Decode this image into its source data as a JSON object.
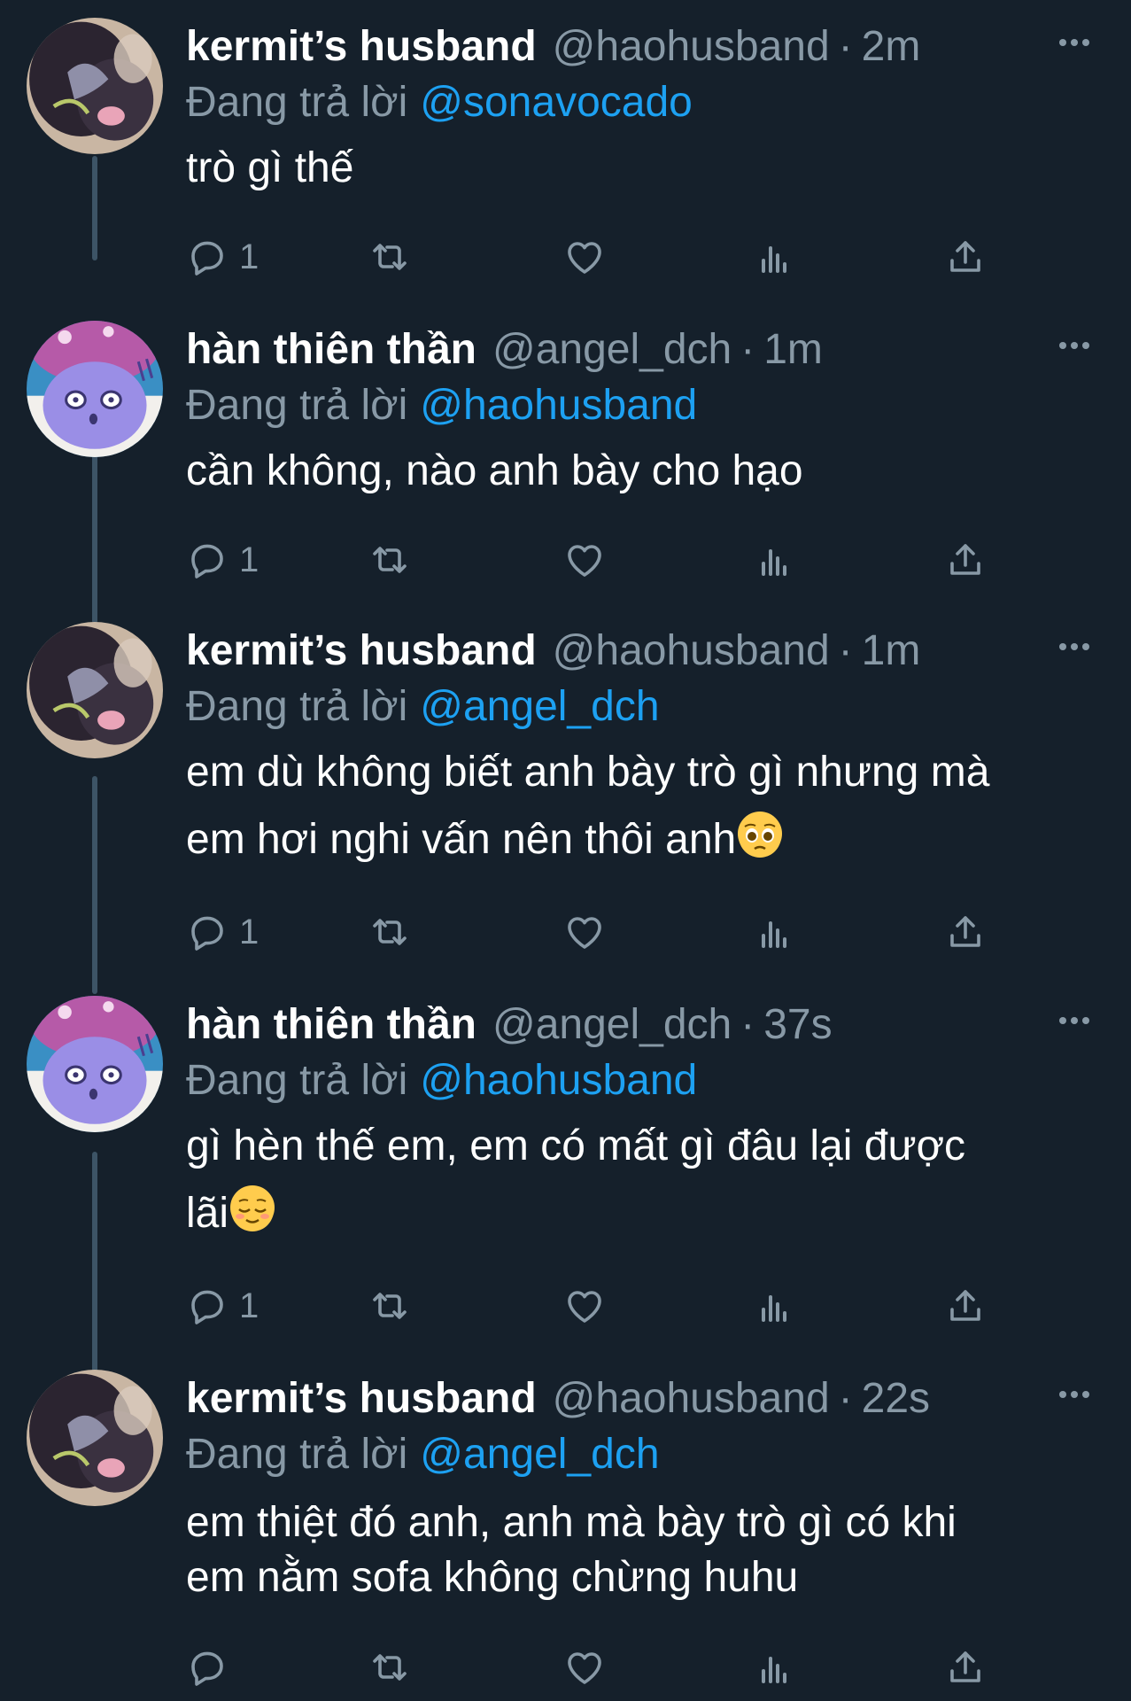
{
  "tweets": [
    {
      "name": "kermit’s husband",
      "handle": "@haohusband",
      "time": "2m",
      "reply_prefix": "Đang trả lời",
      "reply_to": "@sonavocado",
      "lines": [
        "trò gì thế"
      ],
      "reply_count": "1",
      "avatar": "cat-avatar"
    },
    {
      "name": "hàn thiên thần",
      "handle": "@angel_dch",
      "time": "1m",
      "reply_prefix": "Đang trả lời",
      "reply_to": "@haohusband",
      "lines": [
        "cần không, nào anh bày cho hạo"
      ],
      "reply_count": "1",
      "avatar": "cartoon-avatar"
    },
    {
      "name": "kermit’s husband",
      "handle": "@haohusband",
      "time": "1m",
      "reply_prefix": "Đang trả lời",
      "reply_to": "@angel_dch",
      "lines": [
        "em dù không biết anh bày trò gì nhưng mà",
        "em hơi nghi vấn nên thôi anh"
      ],
      "emoji": "pleading-face",
      "reply_count": "1",
      "avatar": "cat-avatar"
    },
    {
      "name": "hàn thiên thần",
      "handle": "@angel_dch",
      "time": "37s",
      "reply_prefix": "Đang trả lời",
      "reply_to": "@haohusband",
      "lines": [
        "gì hèn thế em, em có mất gì đâu lại được",
        "lãi"
      ],
      "emoji": "relieved-face",
      "reply_count": "1",
      "avatar": "cartoon-avatar"
    },
    {
      "name": "kermit’s husband",
      "handle": "@haohusband",
      "time": "22s",
      "reply_prefix": "Đang trả lời",
      "reply_to": "@angel_dch",
      "lines": [
        "em thiệt đó anh, anh mà bày trò gì có khi",
        "em nằm sofa không chừng huhu"
      ],
      "reply_count": "",
      "avatar": "cat-avatar"
    }
  ],
  "theme": {
    "background": "#15202b",
    "text": "#ffffff",
    "muted": "#8899a6",
    "link": "#1da1f2",
    "thread_line": "#3d5466"
  },
  "icons": [
    "reply-icon",
    "retweet-icon",
    "like-icon",
    "analytics-icon",
    "share-icon",
    "more-icon"
  ]
}
